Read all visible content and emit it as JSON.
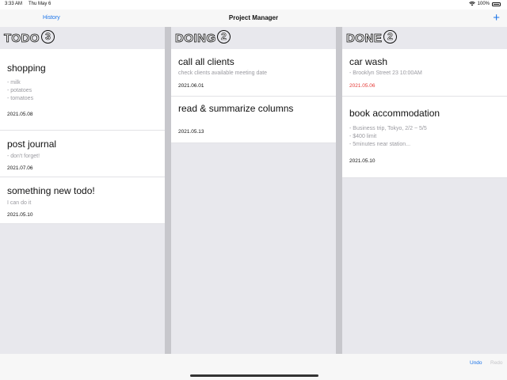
{
  "status_bar": {
    "time": "3:33 AM",
    "date": "Thu May 6",
    "battery": "100%",
    "wifi_icon": "wifi-icon",
    "battery_icon": "battery-icon"
  },
  "nav": {
    "history": "History",
    "title": "Project Manager",
    "add": "+",
    "add_icon": "plus-icon"
  },
  "columns": [
    {
      "title": "TODO",
      "count": "3",
      "cards": [
        {
          "title": "shopping",
          "desc": "- milk\n- potatoes\n- tomatoes",
          "date": "2021.05.08",
          "overdue": false
        },
        {
          "title": "post journal",
          "desc": "- don't forget!",
          "date": "2021.07.06",
          "overdue": false
        },
        {
          "title": "something new todo!",
          "desc": "I can do it",
          "date": "2021.05.10",
          "overdue": false
        }
      ]
    },
    {
      "title": "DOING",
      "count": "2",
      "cards": [
        {
          "title": "call all clients",
          "desc": "check clients available meeting date",
          "date": "2021.06.01",
          "overdue": false
        },
        {
          "title": "read & summarize columns",
          "desc": "",
          "date": "2021.05.13",
          "overdue": false
        }
      ]
    },
    {
      "title": "DONE",
      "count": "2",
      "cards": [
        {
          "title": "car wash",
          "desc": "- Brooklyn Street 23 10:00AM",
          "date": "2021.05.06",
          "overdue": true
        },
        {
          "title": "book accommodation",
          "desc": "- Business trip, Tokyo, 2/2 ~ 5/5\n- $400 limit\n- 5minutes near station...",
          "date": "2021.05.10",
          "overdue": false
        }
      ]
    }
  ],
  "bottom": {
    "undo": "Undo",
    "redo": "Redo"
  },
  "colors": {
    "accent": "#1a73e8",
    "overdue": "#e53935",
    "column_bg": "#e8e8ed",
    "divider": "#c7c7cc"
  }
}
